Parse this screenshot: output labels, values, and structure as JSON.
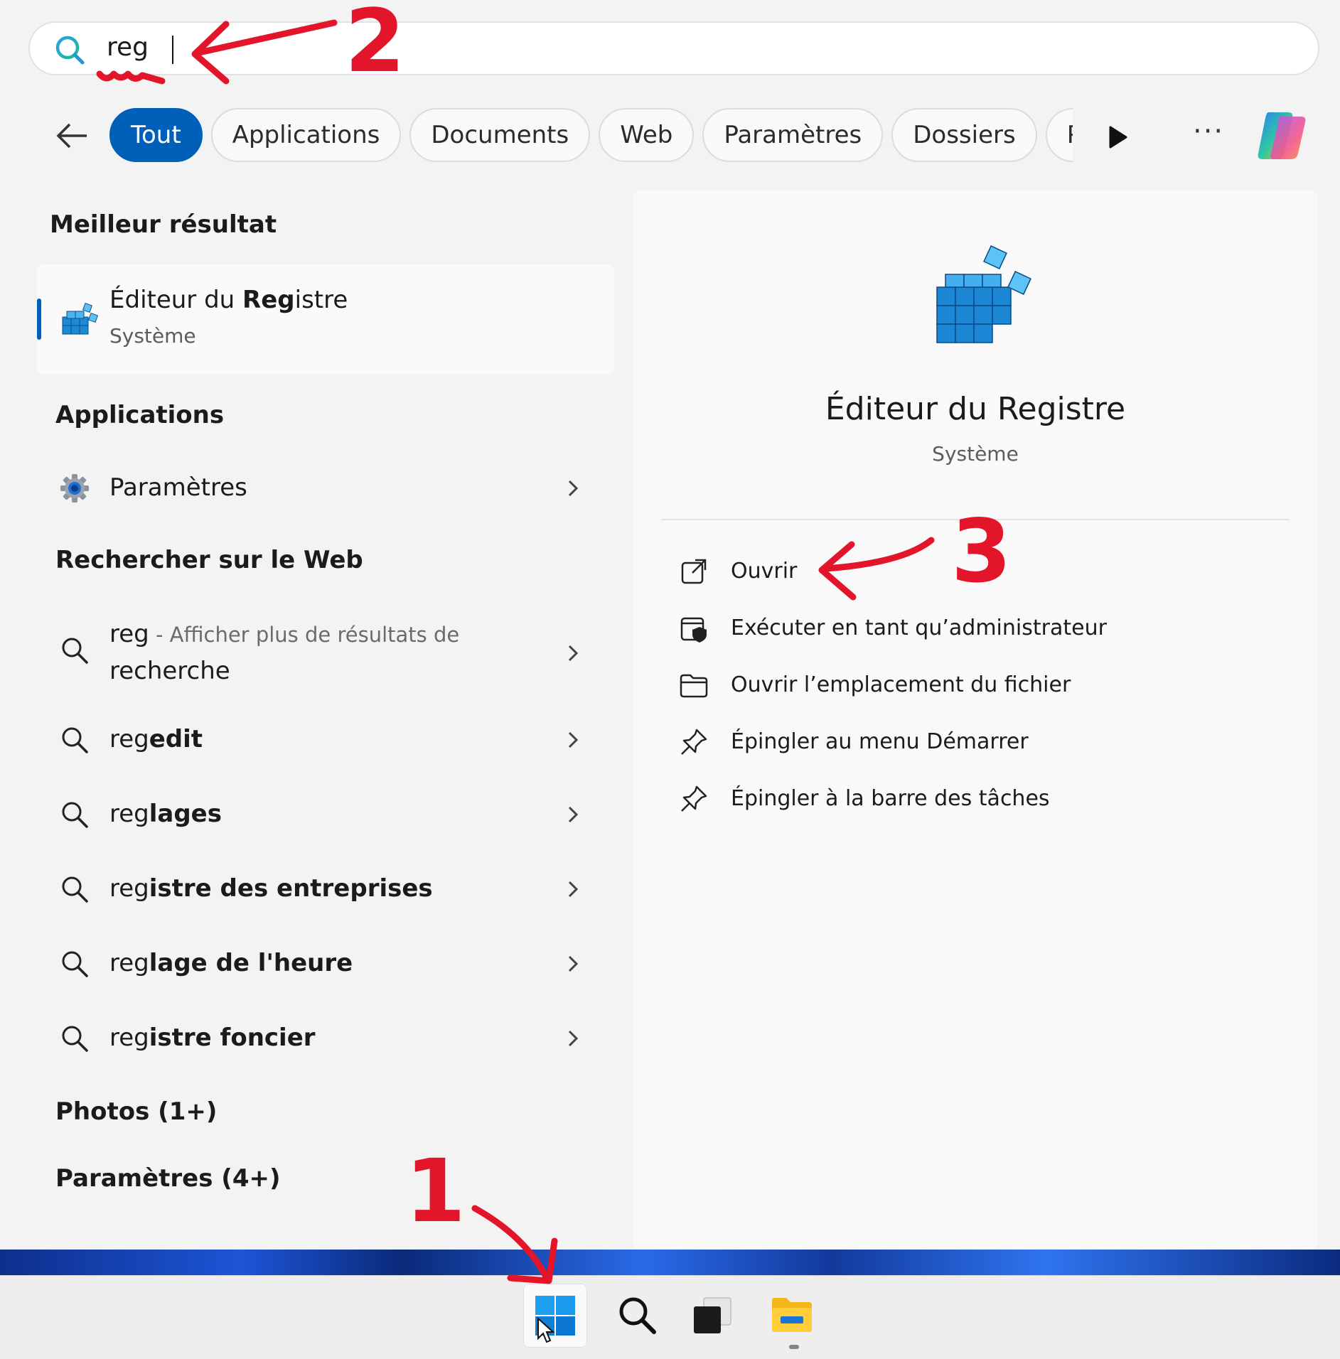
{
  "search": {
    "query": "reg",
    "placeholder": ""
  },
  "filters": [
    "Tout",
    "Applications",
    "Documents",
    "Web",
    "Paramètres",
    "Dossiers",
    "Photc"
  ],
  "icons": {
    "search": "search-icon",
    "back": "back-arrow-icon",
    "play": "play-icon",
    "more": "more-dots-icon",
    "copilot": "copilot-icon",
    "registry": "registry-editor-icon",
    "settings": "gear-icon",
    "chevron": "chevron-right-icon"
  },
  "colors": {
    "accent": "#005fb8",
    "annotation": "#e3152b"
  },
  "best": {
    "section": "Meilleur résultat",
    "name_pre": "Éditeur du ",
    "name_bold": "Reg",
    "name_post": "istre",
    "type": "Système"
  },
  "apps": {
    "section": "Applications",
    "items": [
      {
        "label": "Paramètres"
      }
    ]
  },
  "web": {
    "section": "Rechercher sur le Web",
    "first": {
      "term": "reg",
      "desc_line1": " - Afficher plus de résultats de",
      "desc_line2": "recherche"
    },
    "items": [
      {
        "prefix": "reg",
        "rest": "edit"
      },
      {
        "prefix": "reg",
        "rest": "lages"
      },
      {
        "prefix": "reg",
        "rest": "istre des entreprises"
      },
      {
        "prefix": "reg",
        "rest": "lage de l'heure"
      },
      {
        "prefix": "reg",
        "rest": "istre foncier"
      }
    ]
  },
  "more_sections": [
    "Photos (1+)",
    "Paramètres (4+)"
  ],
  "detail": {
    "title": "Éditeur du Registre",
    "type": "Système",
    "actions": [
      "Ouvrir",
      "Exécuter en tant qu’administrateur",
      "Ouvrir l’emplacement du fichier",
      "Épingler au menu Démarrer",
      "Épingler à la barre des tâches"
    ]
  },
  "annotations": [
    "2",
    "3",
    "1"
  ],
  "taskbar": [
    "windows-start-icon",
    "search-icon",
    "task-view-icon",
    "file-explorer-icon"
  ]
}
